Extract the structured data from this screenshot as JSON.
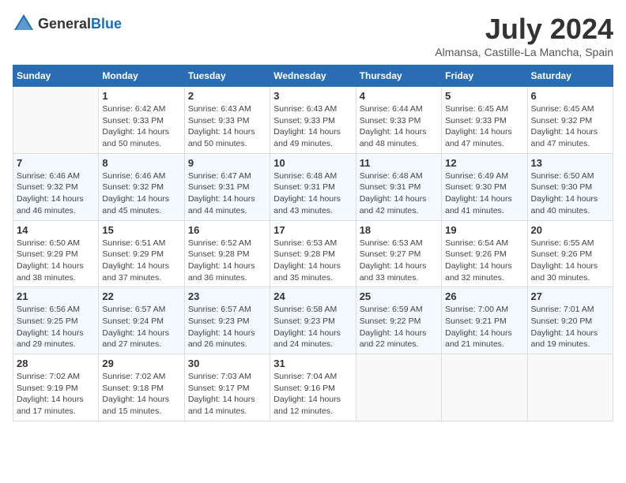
{
  "header": {
    "logo_general": "General",
    "logo_blue": "Blue",
    "title": "July 2024",
    "subtitle": "Almansa, Castille-La Mancha, Spain"
  },
  "weekdays": [
    "Sunday",
    "Monday",
    "Tuesday",
    "Wednesday",
    "Thursday",
    "Friday",
    "Saturday"
  ],
  "weeks": [
    [
      {
        "day": "",
        "empty": true
      },
      {
        "day": "1",
        "sunrise": "Sunrise: 6:42 AM",
        "sunset": "Sunset: 9:33 PM",
        "daylight": "Daylight: 14 hours and 50 minutes."
      },
      {
        "day": "2",
        "sunrise": "Sunrise: 6:43 AM",
        "sunset": "Sunset: 9:33 PM",
        "daylight": "Daylight: 14 hours and 50 minutes."
      },
      {
        "day": "3",
        "sunrise": "Sunrise: 6:43 AM",
        "sunset": "Sunset: 9:33 PM",
        "daylight": "Daylight: 14 hours and 49 minutes."
      },
      {
        "day": "4",
        "sunrise": "Sunrise: 6:44 AM",
        "sunset": "Sunset: 9:33 PM",
        "daylight": "Daylight: 14 hours and 48 minutes."
      },
      {
        "day": "5",
        "sunrise": "Sunrise: 6:45 AM",
        "sunset": "Sunset: 9:33 PM",
        "daylight": "Daylight: 14 hours and 47 minutes."
      },
      {
        "day": "6",
        "sunrise": "Sunrise: 6:45 AM",
        "sunset": "Sunset: 9:32 PM",
        "daylight": "Daylight: 14 hours and 47 minutes."
      }
    ],
    [
      {
        "day": "7",
        "sunrise": "Sunrise: 6:46 AM",
        "sunset": "Sunset: 9:32 PM",
        "daylight": "Daylight: 14 hours and 46 minutes."
      },
      {
        "day": "8",
        "sunrise": "Sunrise: 6:46 AM",
        "sunset": "Sunset: 9:32 PM",
        "daylight": "Daylight: 14 hours and 45 minutes."
      },
      {
        "day": "9",
        "sunrise": "Sunrise: 6:47 AM",
        "sunset": "Sunset: 9:31 PM",
        "daylight": "Daylight: 14 hours and 44 minutes."
      },
      {
        "day": "10",
        "sunrise": "Sunrise: 6:48 AM",
        "sunset": "Sunset: 9:31 PM",
        "daylight": "Daylight: 14 hours and 43 minutes."
      },
      {
        "day": "11",
        "sunrise": "Sunrise: 6:48 AM",
        "sunset": "Sunset: 9:31 PM",
        "daylight": "Daylight: 14 hours and 42 minutes."
      },
      {
        "day": "12",
        "sunrise": "Sunrise: 6:49 AM",
        "sunset": "Sunset: 9:30 PM",
        "daylight": "Daylight: 14 hours and 41 minutes."
      },
      {
        "day": "13",
        "sunrise": "Sunrise: 6:50 AM",
        "sunset": "Sunset: 9:30 PM",
        "daylight": "Daylight: 14 hours and 40 minutes."
      }
    ],
    [
      {
        "day": "14",
        "sunrise": "Sunrise: 6:50 AM",
        "sunset": "Sunset: 9:29 PM",
        "daylight": "Daylight: 14 hours and 38 minutes."
      },
      {
        "day": "15",
        "sunrise": "Sunrise: 6:51 AM",
        "sunset": "Sunset: 9:29 PM",
        "daylight": "Daylight: 14 hours and 37 minutes."
      },
      {
        "day": "16",
        "sunrise": "Sunrise: 6:52 AM",
        "sunset": "Sunset: 9:28 PM",
        "daylight": "Daylight: 14 hours and 36 minutes."
      },
      {
        "day": "17",
        "sunrise": "Sunrise: 6:53 AM",
        "sunset": "Sunset: 9:28 PM",
        "daylight": "Daylight: 14 hours and 35 minutes."
      },
      {
        "day": "18",
        "sunrise": "Sunrise: 6:53 AM",
        "sunset": "Sunset: 9:27 PM",
        "daylight": "Daylight: 14 hours and 33 minutes."
      },
      {
        "day": "19",
        "sunrise": "Sunrise: 6:54 AM",
        "sunset": "Sunset: 9:26 PM",
        "daylight": "Daylight: 14 hours and 32 minutes."
      },
      {
        "day": "20",
        "sunrise": "Sunrise: 6:55 AM",
        "sunset": "Sunset: 9:26 PM",
        "daylight": "Daylight: 14 hours and 30 minutes."
      }
    ],
    [
      {
        "day": "21",
        "sunrise": "Sunrise: 6:56 AM",
        "sunset": "Sunset: 9:25 PM",
        "daylight": "Daylight: 14 hours and 29 minutes."
      },
      {
        "day": "22",
        "sunrise": "Sunrise: 6:57 AM",
        "sunset": "Sunset: 9:24 PM",
        "daylight": "Daylight: 14 hours and 27 minutes."
      },
      {
        "day": "23",
        "sunrise": "Sunrise: 6:57 AM",
        "sunset": "Sunset: 9:23 PM",
        "daylight": "Daylight: 14 hours and 26 minutes."
      },
      {
        "day": "24",
        "sunrise": "Sunrise: 6:58 AM",
        "sunset": "Sunset: 9:23 PM",
        "daylight": "Daylight: 14 hours and 24 minutes."
      },
      {
        "day": "25",
        "sunrise": "Sunrise: 6:59 AM",
        "sunset": "Sunset: 9:22 PM",
        "daylight": "Daylight: 14 hours and 22 minutes."
      },
      {
        "day": "26",
        "sunrise": "Sunrise: 7:00 AM",
        "sunset": "Sunset: 9:21 PM",
        "daylight": "Daylight: 14 hours and 21 minutes."
      },
      {
        "day": "27",
        "sunrise": "Sunrise: 7:01 AM",
        "sunset": "Sunset: 9:20 PM",
        "daylight": "Daylight: 14 hours and 19 minutes."
      }
    ],
    [
      {
        "day": "28",
        "sunrise": "Sunrise: 7:02 AM",
        "sunset": "Sunset: 9:19 PM",
        "daylight": "Daylight: 14 hours and 17 minutes."
      },
      {
        "day": "29",
        "sunrise": "Sunrise: 7:02 AM",
        "sunset": "Sunset: 9:18 PM",
        "daylight": "Daylight: 14 hours and 15 minutes."
      },
      {
        "day": "30",
        "sunrise": "Sunrise: 7:03 AM",
        "sunset": "Sunset: 9:17 PM",
        "daylight": "Daylight: 14 hours and 14 minutes."
      },
      {
        "day": "31",
        "sunrise": "Sunrise: 7:04 AM",
        "sunset": "Sunset: 9:16 PM",
        "daylight": "Daylight: 14 hours and 12 minutes."
      },
      {
        "day": "",
        "empty": true
      },
      {
        "day": "",
        "empty": true
      },
      {
        "day": "",
        "empty": true
      }
    ]
  ]
}
